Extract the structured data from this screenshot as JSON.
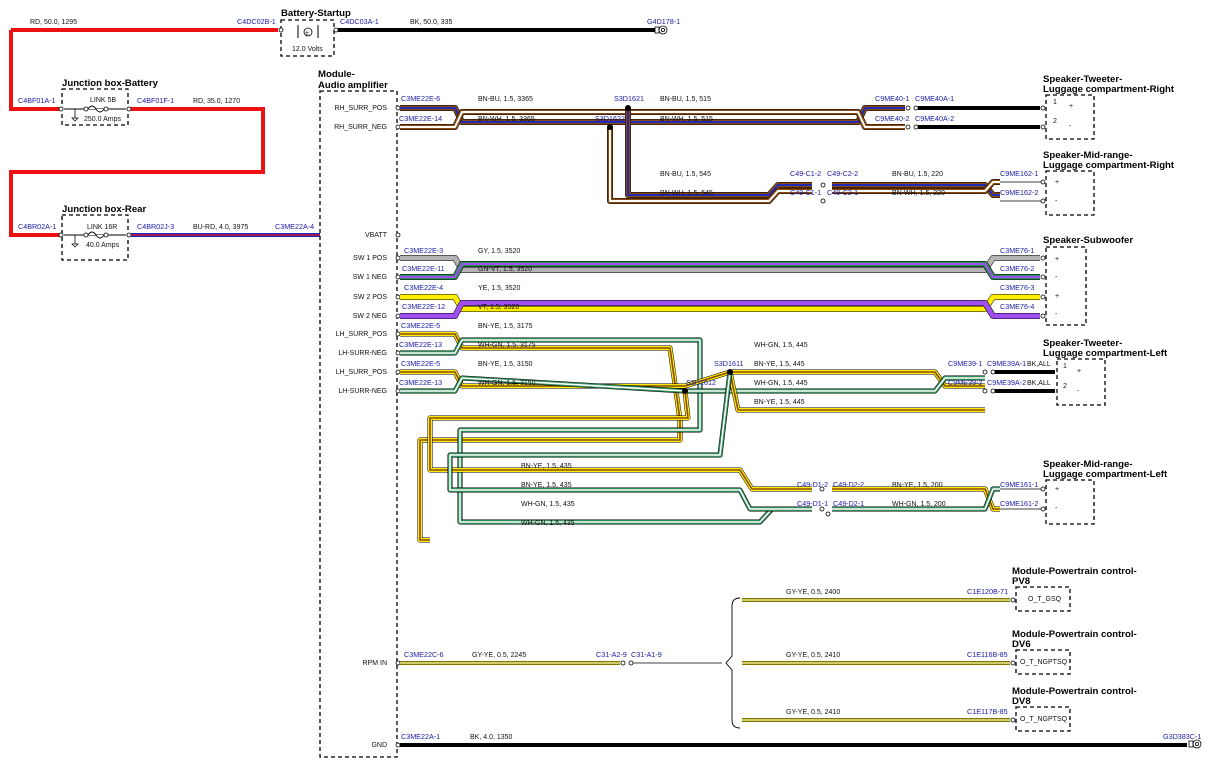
{
  "components": {
    "battery": {
      "title": "Battery-Startup",
      "voltage": "12.0 Volts"
    },
    "jb_battery": {
      "title": "Junction box-Battery",
      "link": "LINK 5B",
      "amps": "250.0 Amps"
    },
    "jb_rear": {
      "title": "Junction box-Rear",
      "link": "LINK 16R",
      "amps": "40.0 Amps"
    },
    "amp": {
      "title_1": "Module-",
      "title_2": "Audio amplifier",
      "pins": [
        "RH_SURR_POS",
        "RH_SURR_NEG",
        "VBATT",
        "SW 1 POS",
        "SW 1 NEG",
        "SW 2 POS",
        "SW 2 NEG",
        "LH_SURR_POS",
        "LH-SURR-NEG",
        "LH_SURR_POS",
        "LH-SURR-NEG",
        "RPM IN",
        "GND"
      ]
    },
    "spk_tw_r": {
      "title_1": "Speaker-Tweeter-",
      "title_2": "Luggage compartment-Right",
      "pins": [
        "1",
        "2",
        "+",
        "-"
      ]
    },
    "spk_mid_r": {
      "title_1": "Speaker-Mid-range-",
      "title_2": "Luggage compartment-Right",
      "pins": [
        "+",
        "-"
      ]
    },
    "spk_sub": {
      "title": "Speaker-Subwoofer",
      "pins": [
        "+",
        "-",
        "+",
        "-"
      ]
    },
    "spk_tw_l": {
      "title_1": "Speaker-Tweeter-",
      "title_2": "Luggage compartment-Left",
      "pins": [
        "1",
        "2",
        "+",
        "-"
      ],
      "bk_all_1": "BK,ALL",
      "bk_all_2": "BK,ALL"
    },
    "spk_mid_l": {
      "title_1": "Speaker-Mid-range-",
      "title_2": "Luggage compartment-Left",
      "pins": [
        "+",
        "-"
      ]
    },
    "pcm_pv8": {
      "title_1": "Module-Powertrain control-",
      "title_2": "PV8",
      "signal": "O_T_GSQ"
    },
    "pcm_dv6": {
      "title_1": "Module-Powertrain control-",
      "title_2": "DV6",
      "signal": "O_T_NGPTSQ"
    },
    "pcm_dv8": {
      "title_1": "Module-Powertrain control-",
      "title_2": "DV8",
      "signal": "O_T_NGPTSQ"
    }
  },
  "connectors": {
    "c4dc02b_1": "C4DC02B-1",
    "c4dc03a_1": "C4DC03A-1",
    "g4d178_1": "G4D178-1",
    "c4bf01a_1": "C4BF01A-1",
    "c4bf01f_1": "C4BF01F-1",
    "c4br02a_1": "C4BR02A-1",
    "c4br02j_3": "C4BR02J-3",
    "c3me22a_4": "C3ME22A-4",
    "c3me22e_6": "C3ME22E-6",
    "c3me22e_14": "C3ME22E-14",
    "s3d1621": "S3D1621",
    "s3d1622": "S3D1622",
    "c9me40_1": "C9ME40-1",
    "c9me40a_1": "C9ME40A-1",
    "c9me40_2": "C9ME40-2",
    "c9me40a_2": "C9ME40A-2",
    "c49_c1_2": "C49-C1-2",
    "c49_c2_2": "C49-C2-2",
    "c49_c1_1": "C49-C1-1",
    "c49_c2_1": "C49-C2-1",
    "c9me162_1": "C9ME162-1",
    "c9me162_2": "C9ME162-2",
    "c3me22e_3": "C3ME22E-3",
    "c3me22e_11": "C3ME22E-11",
    "c3me22e_4": "C3ME22E-4",
    "c3me22e_12": "C3ME22E-12",
    "c3me76_1": "C3ME76-1",
    "c3me76_2": "C3ME76-2",
    "c3me76_3": "C3ME76-3",
    "c3me76_4": "C3ME76-4",
    "c3me22e_5a": "C3ME22E-5",
    "c3me22e_13a": "C3ME22E-13",
    "c3me22e_5b": "C3ME22E-5",
    "c3me22e_13b": "C3ME22E-13",
    "s3d1611": "S3D1611",
    "s3d1612": "S3D1612",
    "c9me39_1": "C9ME39-1",
    "c9me39a_1": "C9ME39A-1",
    "c9me39_2": "C9ME39-2",
    "c9me39a_2": "C9ME39A-2",
    "c49_d1_2": "C49-D1-2",
    "c49_d2_2": "C49-D2-2",
    "c49_d1_1": "C49-D1-1",
    "c49_d2_1": "C49-D2-1",
    "c9me161_1": "C9ME161-1",
    "c9me161_2": "C9ME161-2",
    "c1e120b_71": "C1E120B-71",
    "c1e116b_85": "C1E116B-85",
    "c1e117b_85": "C1E117B-85",
    "c3me22c_6": "C3ME22C-6",
    "c31_a2_9": "C31-A2-9",
    "c31_a1_9": "C31-A1-9",
    "c3me22a_1": "C3ME22A-1",
    "g3d383c_1": "G3D383C-1"
  },
  "wires": {
    "batt_rd": "RD,  50.0,  1295",
    "batt_bk": "BK,  50.0,  335",
    "rd_35": "RD,  35.0,  1270",
    "bu_rd": "BU-RD,  4.0,  3975",
    "rh_bnbu": "BN-BU,  1.5,  3365",
    "rh_bnwh": "BN-WH,  1.5,  3365",
    "tw_r_bnbu": "BN-BU,  1.5,  515",
    "tw_r_bnwh": "BN-WH,  1.5,  515",
    "mid_r_bnbu_a": "BN-BU,  1.5,  545",
    "mid_r_bnwh_a": "BN-WH,  1.5,  545",
    "mid_r_bnbu_b": "BN-BU,  1.5,  220",
    "mid_r_bnwh_b": "BN-WH,  1.5,  220",
    "sw_gy": "GY,  1.5,  3520",
    "sw_gnvt": "GN-VT,  1.5,  3520",
    "sw_ye": "YE,  1.5,  3520",
    "sw_vt": "VT,  1.5,  3520",
    "lh1_bnye": "BN-YE,  1.5,  3175",
    "lh1_whgn": "WH-GN,  1.5,  3175",
    "lh2_bnye": "BN-YE,  1.5,  3150",
    "lh2_whgn": "WH-GN,  1.5,  3150",
    "lh_whgn_445a": "WH-GN,  1.5,  445",
    "lh_bnye_445a": "BN-YE,  1.5,  445",
    "lh_whgn_445b": "WH-GN,  1.5,  445",
    "lh_bnye_445b": "BN-YE,  1.5,  445",
    "lh_bnye_435a": "BN-YE,  1.5,  435",
    "lh_bnye_435b": "BN-YE,  1.5,  435",
    "lh_whgn_435a": "WH-GN,  1.5,  435",
    "lh_whgn_435b": "WH-GN,  1.5,  435",
    "mid_l_bnye": "BN-YE,  1.5,  200",
    "mid_l_whgn": "WH-GN,  1.5,  200",
    "rpm_pv8": "GY-YE,  0.5,  2400",
    "rpm_dv6": "GY-YE,  0.5,  2410",
    "rpm_dv8": "GY-YE,  0.5,  2410",
    "rpm_main": "GY-YE,  0.5,  2245",
    "gnd": "BK,  4.0,  1350"
  },
  "colors": {
    "red": "#ee1111",
    "black": "#000000",
    "brown": "#8a4a14",
    "blue": "#1f2bb8",
    "purple": "#a050f0",
    "white": "#ffffff",
    "gray": "#b4b4b4",
    "green": "#2e8b57",
    "yellow": "#ffee00",
    "label_blue": "#1a1aa6"
  }
}
